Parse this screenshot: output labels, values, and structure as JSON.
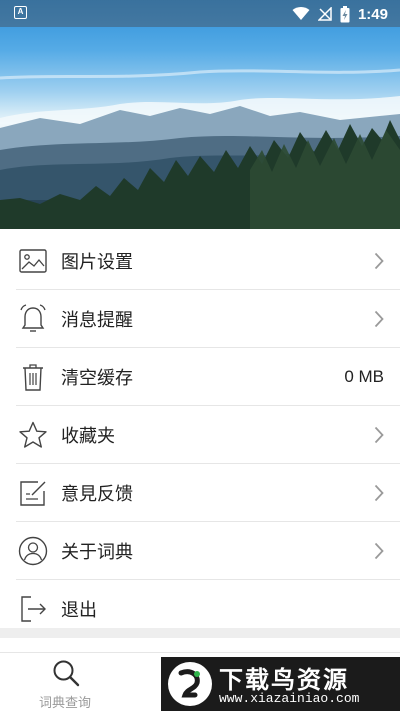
{
  "status_bar": {
    "time": "1:49",
    "notification_glyph": "A",
    "icons": [
      "wifi-icon",
      "no-signal-icon",
      "battery-charging-icon"
    ]
  },
  "menu": {
    "items": [
      {
        "label": "图片设置",
        "icon": "image-icon",
        "trailing": "chevron-right-icon"
      },
      {
        "label": "消息提醒",
        "icon": "alarm-bell-icon",
        "trailing": "chevron-right-icon"
      },
      {
        "label": "清空缓存",
        "icon": "trash-icon",
        "value": "0 MB"
      },
      {
        "label": "收藏夹",
        "icon": "star-icon",
        "trailing": "chevron-right-icon"
      },
      {
        "label": "意見反馈",
        "icon": "edit-note-icon",
        "trailing": "chevron-right-icon"
      },
      {
        "label": "关于词典",
        "icon": "user-circle-icon",
        "trailing": "chevron-right-icon"
      },
      {
        "label": "退出",
        "icon": "logout-icon"
      }
    ]
  },
  "bottom_nav": {
    "tabs": [
      {
        "label": "词典查询",
        "icon": "search-icon"
      }
    ]
  },
  "watermark": {
    "title": "下载鸟资源",
    "url": "www.xiazainiao.com"
  },
  "colors": {
    "text": "#222222",
    "divider": "#e6e6e6",
    "icon": "#444444",
    "chevron": "#9a9a9a"
  }
}
